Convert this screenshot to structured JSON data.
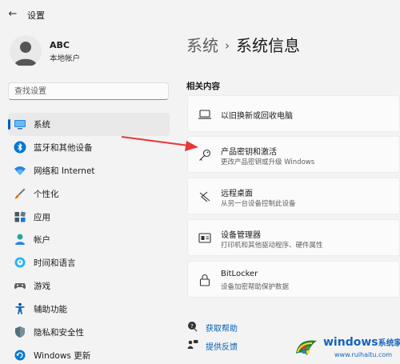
{
  "app": {
    "title": "设置"
  },
  "user": {
    "name": "ABC",
    "account_type": "本地帐户"
  },
  "search": {
    "placeholder": "查找设置"
  },
  "nav": [
    {
      "label": "系统",
      "icon": "system-icon",
      "active": true
    },
    {
      "label": "蓝牙和其他设备",
      "icon": "bluetooth-icon",
      "active": false
    },
    {
      "label": "网络和 Internet",
      "icon": "wifi-icon",
      "active": false
    },
    {
      "label": "个性化",
      "icon": "brush-icon",
      "active": false
    },
    {
      "label": "应用",
      "icon": "apps-icon",
      "active": false
    },
    {
      "label": "帐户",
      "icon": "person-icon",
      "active": false
    },
    {
      "label": "时间和语言",
      "icon": "globe-clock-icon",
      "active": false
    },
    {
      "label": "游戏",
      "icon": "gamepad-icon",
      "active": false
    },
    {
      "label": "辅助功能",
      "icon": "accessibility-icon",
      "active": false
    },
    {
      "label": "隐私和安全性",
      "icon": "shield-icon",
      "active": false
    },
    {
      "label": "Windows 更新",
      "icon": "update-icon",
      "active": false
    }
  ],
  "breadcrumb": {
    "parent": "系统",
    "separator": "›",
    "current": "系统信息"
  },
  "related": {
    "header": "相关内容",
    "items": [
      {
        "title": "以旧换新或回收电脑",
        "subtitle": "",
        "icon": "laptop-icon"
      },
      {
        "title": "产品密钥和激活",
        "subtitle": "更改产品密钥或升级 Windows",
        "icon": "key-icon"
      },
      {
        "title": "远程桌面",
        "subtitle": "从另一台设备控制此设备",
        "icon": "remote-desktop-icon"
      },
      {
        "title": "设备管理器",
        "subtitle": "打印机和其他驱动程序、硬件属性",
        "icon": "device-manager-icon"
      },
      {
        "title": "BitLocker",
        "subtitle": "设备加密帮助保护数据",
        "icon": "lock-icon"
      }
    ]
  },
  "help": {
    "get_help": "获取帮助",
    "feedback": "提供反馈"
  },
  "watermark": {
    "text": "windows",
    "suffix": "系统家园",
    "url": "www.ruihaitu.com"
  },
  "colors": {
    "accent": "#005fb8",
    "arrow": "#e53935",
    "background": "#f3f3f3",
    "card": "#fbfbfb"
  }
}
